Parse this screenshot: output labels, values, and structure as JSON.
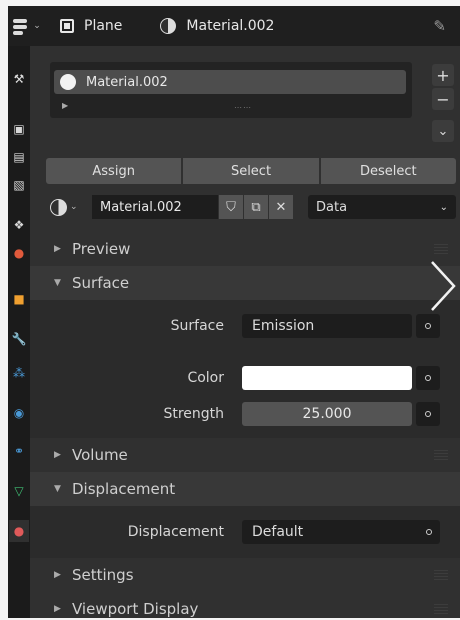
{
  "header": {
    "object_name": "Plane",
    "material_name": "Material.002",
    "editor_icon": "properties-editor-icon",
    "object_icon": "mesh-object-icon",
    "material_icon": "material-icon",
    "pin_icon": "pin-icon"
  },
  "material_slots": {
    "items": [
      {
        "label": "Material.002"
      }
    ],
    "add_label": "+",
    "remove_label": "−",
    "specials_label": "⌄"
  },
  "actions": {
    "assign": "Assign",
    "select": "Select",
    "deselect": "Deselect"
  },
  "datablock": {
    "name": "Material.002",
    "link_mode": "Data",
    "fake_user_icon": "shield-icon",
    "duplicate_icon": "duplicate-icon",
    "unlink_icon": "x-icon"
  },
  "sections": {
    "preview": "Preview",
    "surface": "Surface",
    "volume": "Volume",
    "displacement": "Displacement",
    "settings": "Settings",
    "viewport_display": "Viewport Display"
  },
  "surface": {
    "surface_label": "Surface",
    "surface_value": "Emission",
    "color_label": "Color",
    "color_value": "#ffffff",
    "strength_label": "Strength",
    "strength_value": "25.000"
  },
  "displacement": {
    "displacement_label": "Displacement",
    "displacement_value": "Default"
  },
  "colors": {
    "panel_bg": "#303030",
    "header_bg": "#1f1f1f",
    "field_bg": "#1d1d1d",
    "button_bg": "#545454"
  },
  "tab_icons": [
    "tool-icon",
    "render-icon",
    "output-icon",
    "view-layer-icon",
    "scene-icon",
    "world-icon",
    "object-icon",
    "modifier-icon",
    "particles-icon",
    "physics-icon",
    "constraints-icon",
    "object-data-icon",
    "material-icon"
  ]
}
